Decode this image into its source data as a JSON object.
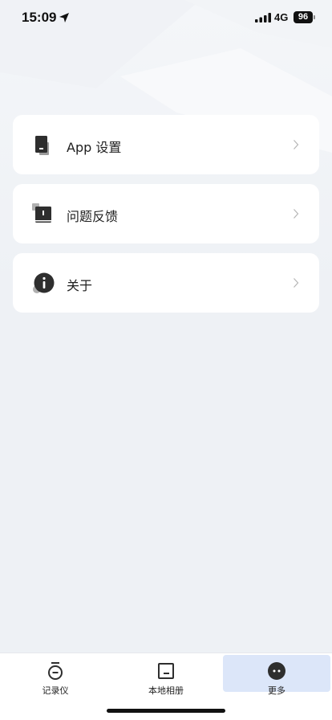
{
  "status_bar": {
    "time": "15:09",
    "network": "4G",
    "battery": "96",
    "icons": [
      "location-arrow-icon",
      "cellular-signal-icon",
      "battery-icon"
    ]
  },
  "menu": {
    "items": [
      {
        "label": "App 设置",
        "icon": "device-icon"
      },
      {
        "label": "问题反馈",
        "icon": "feedback-book-icon"
      },
      {
        "label": "关于",
        "icon": "info-icon"
      }
    ]
  },
  "tab_bar": {
    "tabs": [
      {
        "label": "记录仪",
        "icon": "recorder-icon",
        "active": false
      },
      {
        "label": "本地相册",
        "icon": "album-icon",
        "active": false
      },
      {
        "label": "更多",
        "icon": "more-icon",
        "active": true
      }
    ]
  },
  "colors": {
    "background": "#eef1f5",
    "card": "#ffffff",
    "icon": "#2e2e2e",
    "active_tab": "#dce6f9"
  }
}
